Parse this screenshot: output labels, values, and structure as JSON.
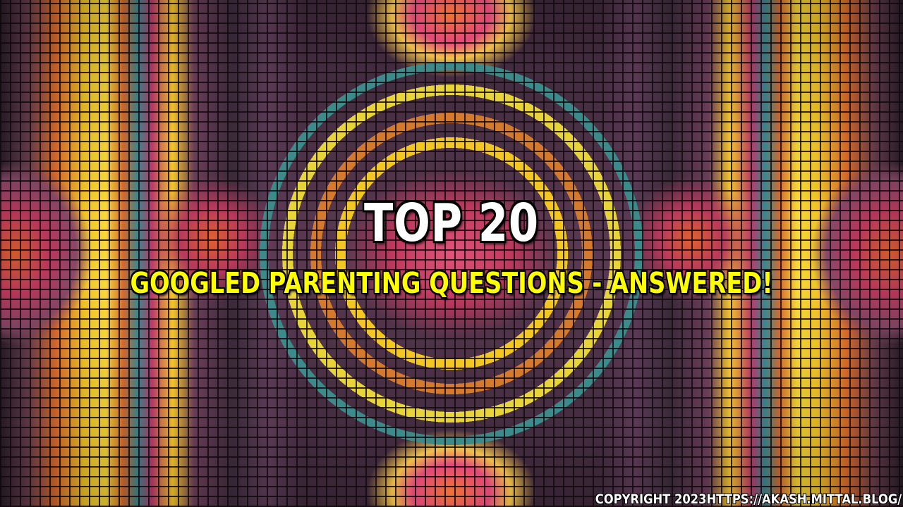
{
  "headline": {
    "title": "TOP 20",
    "subtitle": "GOOGLED PARENTING QUESTIONS - ANSWERED!"
  },
  "footer": {
    "copyright": "COPYRIGHT 2023HTTPS://AKASH.MITTAL.BLOG/"
  },
  "colors": {
    "title": "#ffffff",
    "subtitle": "#ffff00",
    "outline": "#000000"
  }
}
